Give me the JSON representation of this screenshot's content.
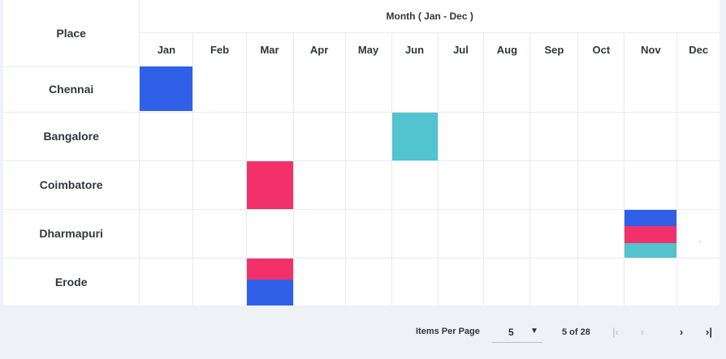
{
  "grid": {
    "place_header": "Place",
    "group_header": "Month ( Jan - Dec )",
    "months": [
      "Jan",
      "Feb",
      "Mar",
      "Apr",
      "May",
      "Jun",
      "Jul",
      "Aug",
      "Sep",
      "Oct",
      "Nov",
      "Dec"
    ],
    "rows": [
      {
        "place": "Chennai",
        "marks": [
          {
            "month": "Jan",
            "colors": [
              "#3060e8"
            ]
          }
        ]
      },
      {
        "place": "Bangalore",
        "marks": [
          {
            "month": "Jun",
            "colors": [
              "#52c3cf"
            ]
          }
        ]
      },
      {
        "place": "Coimbatore",
        "marks": [
          {
            "month": "Mar",
            "colors": [
              "#f2316a"
            ]
          }
        ]
      },
      {
        "place": "Dharmapuri",
        "marks": [
          {
            "month": "Nov",
            "colors": [
              "#3060e8",
              "#f2316a",
              "#52c3cf"
            ]
          }
        ]
      },
      {
        "place": "Erode",
        "marks": [
          {
            "month": "Mar",
            "colors": [
              "#f2316a",
              "#3060e8"
            ]
          }
        ]
      }
    ]
  },
  "pager": {
    "items_per_page_label": "Items Per Page",
    "items_per_page_value": "5",
    "count_text": "5 of 28"
  },
  "colors": {
    "blue": "#3060e8",
    "cyan": "#52c3cf",
    "pink": "#f2316a",
    "background": "#eef1f6"
  }
}
